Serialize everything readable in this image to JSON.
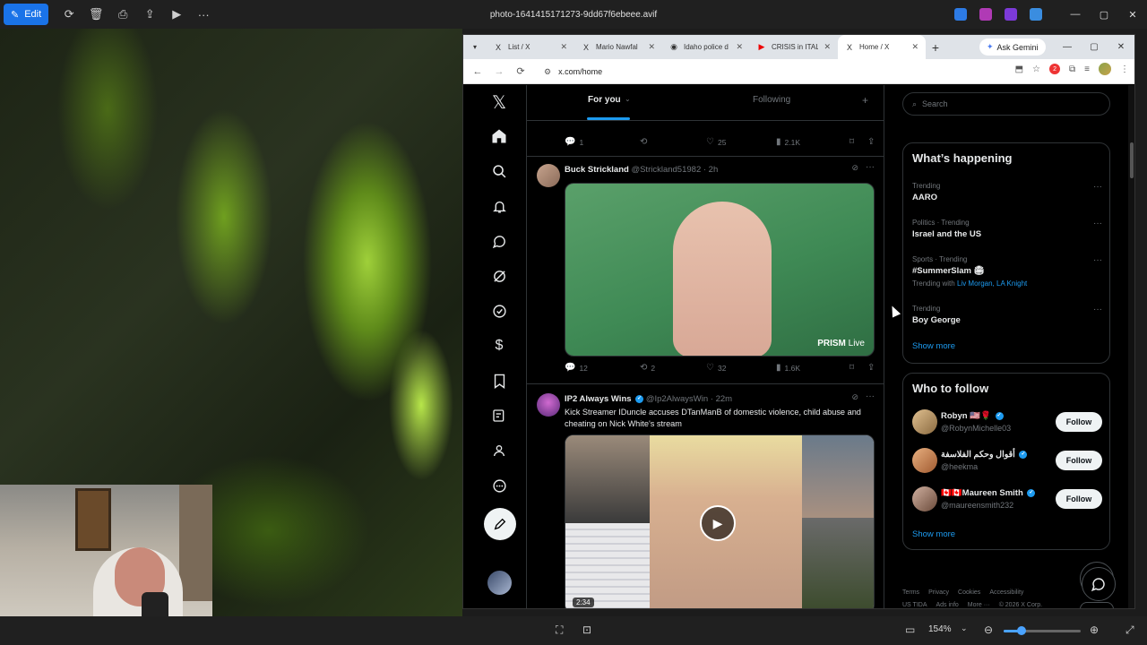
{
  "viewer": {
    "edit_label": "Edit",
    "file_title": "photo-1641415171273-9dd67f6ebeee.avif",
    "zoom": "154%"
  },
  "browser": {
    "tabs": [
      {
        "label": "List / X",
        "favicon": "X"
      },
      {
        "label": "Mario Nawfal",
        "favicon": "X"
      },
      {
        "label": "Idaho police d",
        "favicon": "◉"
      },
      {
        "label": "CRISIS in ITALY",
        "favicon": "▶"
      },
      {
        "label": "Home / X",
        "favicon": "X",
        "active": true
      }
    ],
    "gemini_label": "Ask Gemini",
    "url": "x.com/home",
    "ext_badge": "2"
  },
  "timeline": {
    "tab_for_you": "For you",
    "tab_following": "Following",
    "prev_post_actions": {
      "replies": "1",
      "reposts": "",
      "likes": "25",
      "views": "2.1K"
    },
    "tweets": [
      {
        "name": "Buck Strickland",
        "handle": "@Strickland51982 · 2h",
        "text": "",
        "media_badge": "PRISM",
        "media_badge_live": "Live",
        "actions": {
          "replies": "12",
          "reposts": "2",
          "likes": "32",
          "views": "1.6K"
        }
      },
      {
        "name": "IP2 Always Wins",
        "handle": "@Ip2AlwaysWin · 22m",
        "text": "Kick Streamer IDuncle accuses DTanManB of domestic violence, child abuse and cheating on Nick White's stream",
        "duration": "2:34"
      }
    ]
  },
  "sidebar": {
    "search_placeholder": "Search",
    "whats_happening_title": "What’s happening",
    "trends": [
      {
        "meta": "Trending",
        "name": "AARO",
        "with": ""
      },
      {
        "meta": "Politics · Trending",
        "name": "Israel and the US",
        "with": ""
      },
      {
        "meta": "Sports · Trending",
        "name": "#SummerSlam 🏟",
        "with_prefix": "Trending with",
        "with": "Liv Morgan, LA Knight"
      },
      {
        "meta": "Trending",
        "name": "Boy George",
        "with": ""
      }
    ],
    "show_more": "Show more",
    "who_to_follow_title": "Who to follow",
    "follow_suggestions": [
      {
        "name": "Robyn 🇺🇸🌹",
        "handle": "@RobynMichelle03",
        "button": "Follow"
      },
      {
        "name": "أقوال وحكم الفلاسفة",
        "handle": "@heekma",
        "button": "Follow"
      },
      {
        "name": "🇨🇦🇨🇦Maureen Smith",
        "handle": "@maureensmith232",
        "button": "Follow"
      }
    ],
    "show_more_2": "Show more",
    "footer": [
      "Terms",
      "Privacy",
      "Cookies",
      "Accessibility",
      "US TIDA",
      "Ads info",
      "More ···",
      "© 2026 X Corp."
    ]
  }
}
